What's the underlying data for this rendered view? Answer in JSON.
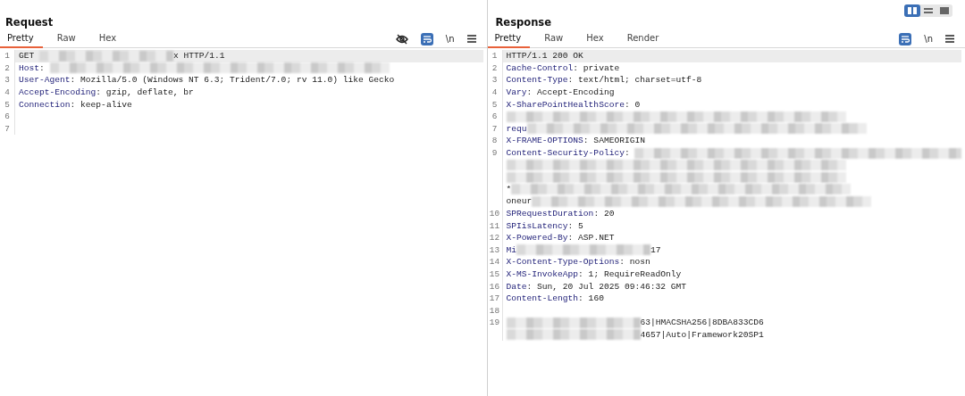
{
  "layout_toggles": [
    {
      "kind": "columns",
      "selected": true
    },
    {
      "kind": "rows",
      "selected": false
    },
    {
      "kind": "single",
      "selected": false
    }
  ],
  "panels": [
    {
      "title": "Request",
      "tabs": [
        {
          "label": "Pretty",
          "selected": true
        },
        {
          "label": "Raw",
          "selected": false
        },
        {
          "label": "Hex",
          "selected": false
        }
      ],
      "tools": [
        {
          "kind": "hide"
        },
        {
          "kind": "wrap",
          "on": true
        },
        {
          "kind": "newline",
          "label": "\\n"
        },
        {
          "kind": "menu"
        }
      ],
      "lines": [
        {
          "number": "1",
          "selected": true,
          "segments": [
            {
              "kind": "text",
              "text": "GET "
            },
            {
              "kind": "redacted"
            },
            {
              "kind": "text",
              "text": "x HTTP/1.1"
            }
          ]
        },
        {
          "number": "2",
          "selected": false,
          "segments": [
            {
              "kind": "key",
              "text": "Host"
            },
            {
              "kind": "text",
              "text": ": "
            },
            {
              "kind": "redacted"
            }
          ]
        },
        {
          "number": "3",
          "selected": false,
          "segments": [
            {
              "kind": "key",
              "text": "User-Agent"
            },
            {
              "kind": "text",
              "text": ": Mozilla/5.0 (Windows NT 6.3; Trident/7.0; rv 11.0) like Gecko"
            }
          ]
        },
        {
          "number": "4",
          "selected": false,
          "segments": [
            {
              "kind": "key",
              "text": "Accept-Encoding"
            },
            {
              "kind": "text",
              "text": ": gzip, deflate, br"
            }
          ]
        },
        {
          "number": "5",
          "selected": false,
          "segments": [
            {
              "kind": "key",
              "text": "Connection"
            },
            {
              "kind": "text",
              "text": ": keep-alive"
            }
          ]
        },
        {
          "number": "6",
          "selected": false
        },
        {
          "number": "7",
          "selected": false
        }
      ]
    },
    {
      "title": "Response",
      "tabs": [
        {
          "label": "Pretty",
          "selected": true
        },
        {
          "label": "Raw",
          "selected": false
        },
        {
          "label": "Hex",
          "selected": false
        },
        {
          "label": "Render",
          "selected": false
        }
      ],
      "tools": [
        {
          "kind": "wrap",
          "on": true
        },
        {
          "kind": "newline",
          "label": "\\n"
        },
        {
          "kind": "menu"
        }
      ],
      "lines": [
        {
          "number": "1",
          "selected": true,
          "segments": [
            {
              "kind": "text",
              "text": "HTTP/1.1 200 OK"
            }
          ]
        },
        {
          "number": "2",
          "selected": false,
          "segments": [
            {
              "kind": "key",
              "text": "Cache-Control"
            },
            {
              "kind": "text",
              "text": ": private"
            }
          ]
        },
        {
          "number": "3",
          "selected": false,
          "segments": [
            {
              "kind": "key",
              "text": "Content-Type"
            },
            {
              "kind": "text",
              "text": ": text/html; charset=utf-8"
            }
          ]
        },
        {
          "number": "4",
          "selected": false,
          "segments": [
            {
              "kind": "key",
              "text": "Vary"
            },
            {
              "kind": "text",
              "text": ": Accept-Encoding"
            }
          ]
        },
        {
          "number": "5",
          "selected": false,
          "segments": [
            {
              "kind": "key",
              "text": "X-SharePointHealthScore"
            },
            {
              "kind": "text",
              "text": ": 0"
            }
          ]
        },
        {
          "number": "6",
          "selected": false,
          "segments": [
            {
              "kind": "redacted"
            }
          ]
        },
        {
          "number": "7",
          "selected": false,
          "segments": [
            {
              "kind": "key",
              "text": "requ"
            },
            {
              "kind": "redacted"
            }
          ]
        },
        {
          "number": "8",
          "selected": false,
          "segments": [
            {
              "kind": "key",
              "text": "X-FRAME-OPTIONS"
            },
            {
              "kind": "text",
              "text": ": SAMEORIGIN"
            }
          ]
        },
        {
          "number": "9",
          "selected": false,
          "segments": [
            {
              "kind": "key",
              "text": "Content-Security-Policy"
            },
            {
              "kind": "text",
              "text": ": "
            },
            {
              "kind": "redacted"
            }
          ]
        },
        {
          "selected": false,
          "segments": [
            {
              "kind": "redacted"
            }
          ]
        },
        {
          "selected": false,
          "segments": [
            {
              "kind": "redacted"
            }
          ]
        },
        {
          "selected": false,
          "segments": [
            {
              "kind": "text",
              "text": "*"
            },
            {
              "kind": "redacted"
            }
          ]
        },
        {
          "selected": false,
          "segments": [
            {
              "kind": "text",
              "text": "oneur"
            },
            {
              "kind": "redacted"
            }
          ]
        },
        {
          "number": "10",
          "selected": false,
          "segments": [
            {
              "kind": "key",
              "text": "SPRequestDuration"
            },
            {
              "kind": "text",
              "text": ": 20"
            }
          ]
        },
        {
          "number": "11",
          "selected": false,
          "segments": [
            {
              "kind": "key",
              "text": "SPIisLatency"
            },
            {
              "kind": "text",
              "text": ": 5"
            }
          ]
        },
        {
          "number": "12",
          "selected": false,
          "segments": [
            {
              "kind": "key",
              "text": "X-Powered-By"
            },
            {
              "kind": "text",
              "text": ": ASP.NET"
            }
          ]
        },
        {
          "number": "13",
          "selected": false,
          "segments": [
            {
              "kind": "key",
              "text": "Mi"
            },
            {
              "kind": "redacted"
            },
            {
              "kind": "text",
              "text": "17"
            }
          ]
        },
        {
          "number": "14",
          "selected": false,
          "segments": [
            {
              "kind": "key",
              "text": "X-Content-Type-Options"
            },
            {
              "kind": "text",
              "text": ": nosn"
            }
          ]
        },
        {
          "number": "15",
          "selected": false,
          "segments": [
            {
              "kind": "key",
              "text": "X-MS-InvokeApp"
            },
            {
              "kind": "text",
              "text": ": 1; RequireReadOnly"
            }
          ]
        },
        {
          "number": "16",
          "selected": false,
          "segments": [
            {
              "kind": "key",
              "text": "Date"
            },
            {
              "kind": "text",
              "text": ": Sun, 20 Jul 2025 09:46:32 GMT"
            }
          ]
        },
        {
          "number": "17",
          "selected": false,
          "segments": [
            {
              "kind": "key",
              "text": "Content-Length"
            },
            {
              "kind": "text",
              "text": ": 160"
            }
          ]
        },
        {
          "number": "18",
          "selected": false
        },
        {
          "number": "19",
          "selected": false,
          "segments": [
            {
              "kind": "redacted"
            },
            {
              "kind": "text",
              "text": "63|HMACSHA256|8DBA833CD6"
            }
          ]
        },
        {
          "selected": false,
          "segments": [
            {
              "kind": "redacted"
            },
            {
              "kind": "text",
              "text": "4657|Auto|Framework20SP1"
            }
          ]
        }
      ]
    }
  ]
}
